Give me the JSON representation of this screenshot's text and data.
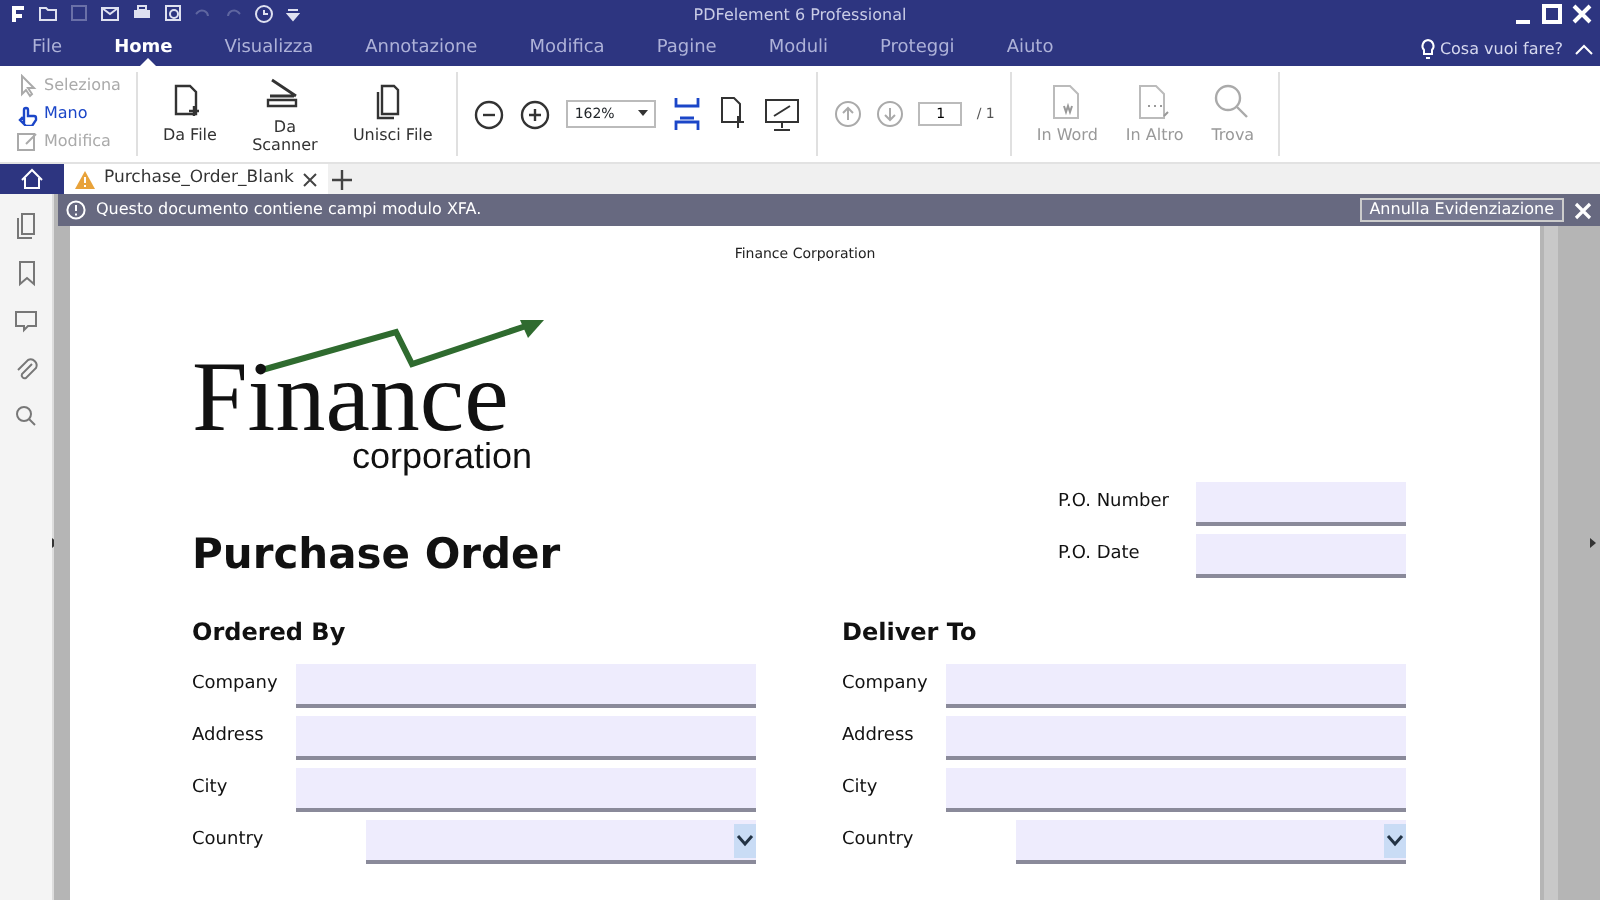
{
  "window": {
    "title": "PDFelement 6 Professional"
  },
  "menu_tabs": [
    {
      "label": "File",
      "selected": false
    },
    {
      "label": "Home",
      "selected": true
    },
    {
      "label": "Visualizza",
      "selected": false
    },
    {
      "label": "Annotazione",
      "selected": false
    },
    {
      "label": "Modifica",
      "selected": false
    },
    {
      "label": "Pagine",
      "selected": false
    },
    {
      "label": "Moduli",
      "selected": false
    },
    {
      "label": "Proteggi",
      "selected": false
    },
    {
      "label": "Aiuto",
      "selected": false
    }
  ],
  "help_search": {
    "label": "Cosa vuoi fare?"
  },
  "ribbon": {
    "modes": [
      {
        "kind": "select",
        "label": "Seleziona",
        "selected": false,
        "disabled": true
      },
      {
        "kind": "hand",
        "label": "Mano",
        "selected": true,
        "disabled": false
      },
      {
        "kind": "edit",
        "label": "Modifica",
        "selected": false,
        "disabled": true
      }
    ],
    "create": [
      {
        "kind": "file",
        "label": "Da File"
      },
      {
        "kind": "scanner",
        "label": "Da Scanner"
      },
      {
        "kind": "merge",
        "label": "Unisci File"
      }
    ],
    "zoom": {
      "value": "162%"
    },
    "page": {
      "value": "1",
      "total": "/ 1"
    },
    "convert": [
      {
        "kind": "word",
        "label": "In Word",
        "disabled": true
      },
      {
        "kind": "other",
        "label": "In Altro",
        "disabled": true
      },
      {
        "kind": "find",
        "label": "Trova",
        "disabled": true
      }
    ]
  },
  "doc_tabs": [
    {
      "label": "Purchase_Order_Blank",
      "selected": true,
      "warning": true
    }
  ],
  "notice": {
    "text": "Questo documento contiene campi modulo XFA.",
    "button": "Annulla Evidenziazione"
  },
  "document": {
    "header": "Finance Corporation",
    "logo": {
      "name": "Finance",
      "sub": "corporation"
    },
    "title": "Purchase Order",
    "po_fields": [
      {
        "label": "P.O. Number"
      },
      {
        "label": "P.O. Date"
      }
    ],
    "sections": [
      {
        "heading": "Ordered By",
        "fields": [
          {
            "label": "Company",
            "kind": "text"
          },
          {
            "label": "Address",
            "kind": "text"
          },
          {
            "label": "City",
            "kind": "text"
          },
          {
            "label": "Country",
            "kind": "select"
          }
        ]
      },
      {
        "heading": "Deliver To",
        "fields": [
          {
            "label": "Company",
            "kind": "text"
          },
          {
            "label": "Address",
            "kind": "text"
          },
          {
            "label": "City",
            "kind": "text"
          },
          {
            "label": "Country",
            "kind": "select"
          }
        ]
      }
    ]
  }
}
